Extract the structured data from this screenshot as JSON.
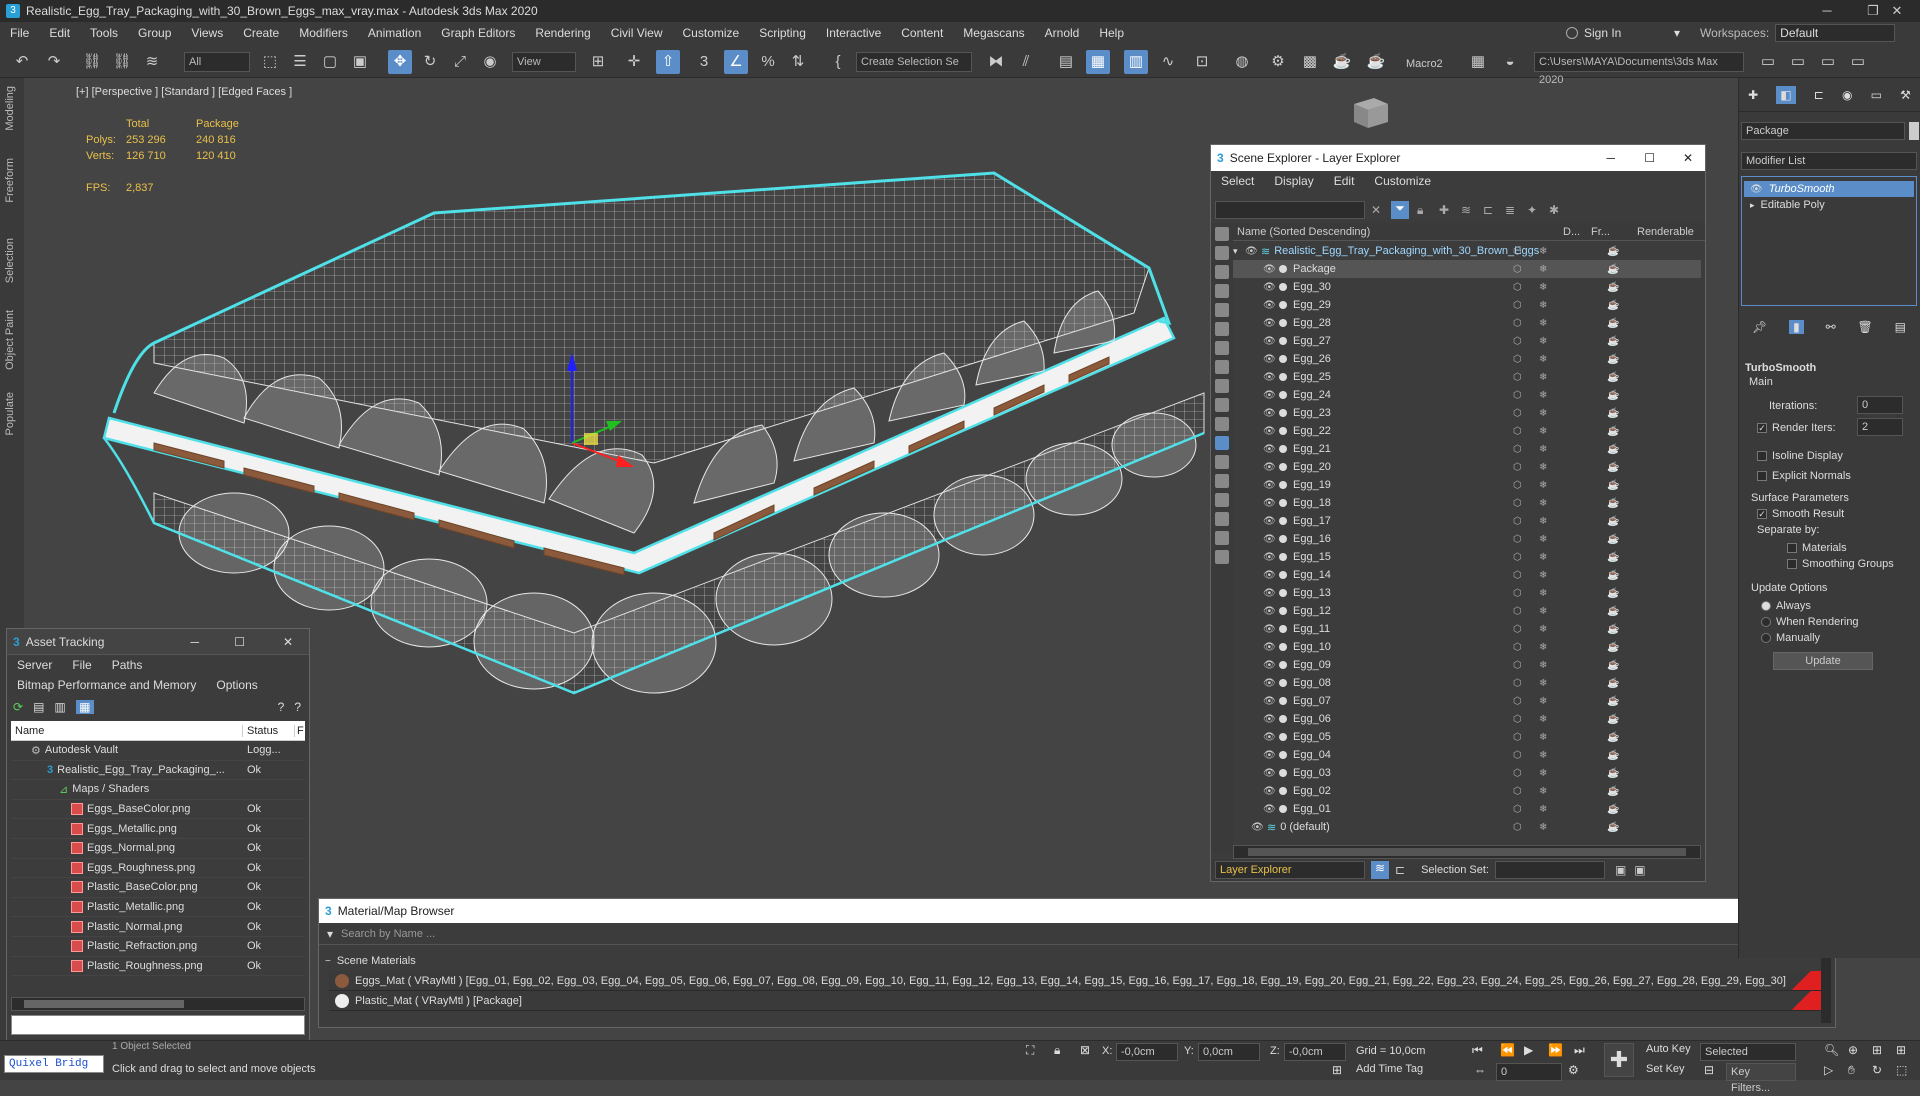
{
  "window": {
    "title": "Realistic_Egg_Tray_Packaging_with_30_Brown_Eggs_max_vray.max - Autodesk 3ds Max 2020"
  },
  "menu": [
    "File",
    "Edit",
    "Tools",
    "Group",
    "Views",
    "Create",
    "Modifiers",
    "Animation",
    "Graph Editors",
    "Rendering",
    "Civil View",
    "Customize",
    "Scripting",
    "Interactive",
    "Content",
    "Megascans",
    "Arnold",
    "Help"
  ],
  "account": {
    "sign_in": "Sign In",
    "workspaces_label": "Workspaces:",
    "workspace_value": "Default"
  },
  "toolbar": {
    "filter_value": "All",
    "view_value": "View",
    "create_selection": "Create Selection Se",
    "macro": "Macro2",
    "project_path": "C:\\Users\\MAYA\\Documents\\3ds Max 2020"
  },
  "left_tabs": [
    "Modeling",
    "Freeform",
    "Selection",
    "Object Paint",
    "Populate"
  ],
  "viewport": {
    "label": "[+] [Perspective ] [Standard ] [Edged Faces ]",
    "stats": {
      "total_label": "Total",
      "package_label": "Package",
      "polys_label": "Polys:",
      "polys_total": "253 296",
      "polys_package": "240 816",
      "verts_label": "Verts:",
      "verts_total": "126 710",
      "verts_package": "120 410",
      "fps_label": "FPS:",
      "fps_value": "2,837"
    }
  },
  "scene_explorer": {
    "title": "Scene Explorer - Layer Explorer",
    "menu": [
      "Select",
      "Display",
      "Edit",
      "Customize"
    ],
    "col_name": "Name (Sorted Descending)",
    "col_d": "D...",
    "col_fr": "Fr...",
    "col_renderable": "Renderable",
    "root": "Realistic_Egg_Tray_Packaging_with_30_Brown_Eggs",
    "items": [
      "Package",
      "Egg_30",
      "Egg_29",
      "Egg_28",
      "Egg_27",
      "Egg_26",
      "Egg_25",
      "Egg_24",
      "Egg_23",
      "Egg_22",
      "Egg_21",
      "Egg_20",
      "Egg_19",
      "Egg_18",
      "Egg_17",
      "Egg_16",
      "Egg_15",
      "Egg_14",
      "Egg_13",
      "Egg_12",
      "Egg_11",
      "Egg_10",
      "Egg_09",
      "Egg_08",
      "Egg_07",
      "Egg_06",
      "Egg_05",
      "Egg_04",
      "Egg_03",
      "Egg_02",
      "Egg_01"
    ],
    "default_layer": "0 (default)",
    "footer_dropdown": "Layer Explorer",
    "selection_set_label": "Selection Set:"
  },
  "asset_tracking": {
    "title": "Asset Tracking",
    "menu1": [
      "Server",
      "File",
      "Paths"
    ],
    "menu2": [
      "Bitmap Performance and Memory",
      "Options"
    ],
    "col_name": "Name",
    "col_status": "Status",
    "col_extra": "F",
    "rows": [
      {
        "name": "Autodesk Vault",
        "status": "Logg..."
      },
      {
        "name": "Realistic_Egg_Tray_Packaging_...",
        "status": "Ok"
      },
      {
        "name": "Maps / Shaders",
        "status": ""
      },
      {
        "name": "Eggs_BaseColor.png",
        "status": "Ok"
      },
      {
        "name": "Eggs_Metallic.png",
        "status": "Ok"
      },
      {
        "name": "Eggs_Normal.png",
        "status": "Ok"
      },
      {
        "name": "Eggs_Roughness.png",
        "status": "Ok"
      },
      {
        "name": "Plastic_BaseColor.png",
        "status": "Ok"
      },
      {
        "name": "Plastic_Metallic.png",
        "status": "Ok"
      },
      {
        "name": "Plastic_Normal.png",
        "status": "Ok"
      },
      {
        "name": "Plastic_Refraction.png",
        "status": "Ok"
      },
      {
        "name": "Plastic_Roughness.png",
        "status": "Ok"
      }
    ]
  },
  "material_browser": {
    "title": "Material/Map Browser",
    "search_placeholder": "Search by Name ...",
    "section": "Scene Materials",
    "materials": [
      "Eggs_Mat  ( VRayMtl )  [Egg_01, Egg_02, Egg_03, Egg_04, Egg_05, Egg_06, Egg_07, Egg_08, Egg_09, Egg_10, Egg_11, Egg_12, Egg_13, Egg_14, Egg_15, Egg_16, Egg_17, Egg_18, Egg_19, Egg_20, Egg_21, Egg_22, Egg_23, Egg_24, Egg_25, Egg_26, Egg_27, Egg_28, Egg_29, Egg_30]",
      "Plastic_Mat  ( VRayMtl )  [Package]"
    ]
  },
  "command_panel": {
    "object_name": "Package",
    "modifier_list": "Modifier List",
    "stack": [
      "TurboSmooth",
      "Editable Poly"
    ],
    "rollout_title": "TurboSmooth",
    "main_label": "Main",
    "iterations_label": "Iterations:",
    "iterations_value": "0",
    "render_iters_label": "Render Iters:",
    "render_iters_value": "2",
    "isoline": "Isoline Display",
    "explicit_normals": "Explicit Normals",
    "surface_params": "Surface Parameters",
    "smooth_result": "Smooth Result",
    "separate_by": "Separate by:",
    "materials": "Materials",
    "smoothing_groups": "Smoothing Groups",
    "update_options": "Update Options",
    "always": "Always",
    "when_rendering": "When Rendering",
    "manually": "Manually",
    "update_button": "Update"
  },
  "status": {
    "quixel": "Quixel Bridg",
    "selected_objects": "1 Object Selected",
    "prompt": "Click and drag to select and move objects",
    "x_label": "X:",
    "x_value": "-0,0cm",
    "y_label": "Y:",
    "y_value": "0,0cm",
    "z_label": "Z:",
    "z_value": "-0,0cm",
    "grid": "Grid = 10,0cm",
    "add_time_tag": "Add Time Tag",
    "auto_key": "Auto Key",
    "set_key": "Set Key",
    "selected_dropdown": "Selected",
    "key_filters": "Key Filters...",
    "frame_value": "0"
  },
  "colors": {
    "accent": "#5b8ec9",
    "wire_highlight": "#4fe0e8",
    "wire": "#e8e8e8",
    "egg_brown": "#8b5a3c",
    "stats_yellow": "#e8c04a"
  }
}
